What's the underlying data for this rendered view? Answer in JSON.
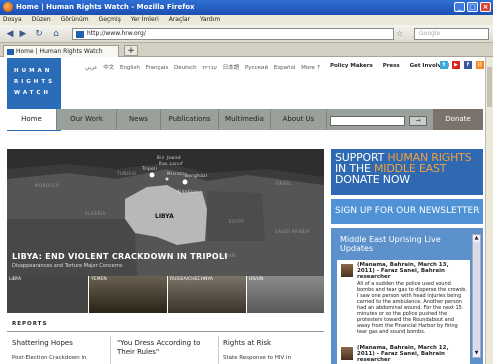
{
  "window": {
    "title": "Home | Human Rights Watch - Mozilla Firefox"
  },
  "menu": [
    "Dosya",
    "Düzen",
    "Görünüm",
    "Geçmiş",
    "Yer İmleri",
    "Araçlar",
    "Yardım"
  ],
  "toolbar": {
    "url": "http://www.hrw.org/",
    "search_placeholder": "Google"
  },
  "tab": {
    "label": "Home | Human Rights Watch",
    "new_tab": "+"
  },
  "site": {
    "logo_lines": [
      "HUMAN",
      "RIGHTS",
      "WATCH"
    ],
    "languages": [
      "عربي",
      "中文",
      "English",
      "Français",
      "Deutsch",
      "עברית",
      "日本語",
      "Русский",
      "Español",
      "More ↑"
    ],
    "top_links": [
      "Policy Makers",
      "Press",
      "Get Involved"
    ],
    "social_icons": [
      "twitter-icon",
      "youtube-icon",
      "facebook-icon",
      "rss-icon"
    ],
    "nav": [
      "Home",
      "Our Work",
      "News",
      "Publications",
      "Multimedia",
      "About Us"
    ],
    "donate": "Donate",
    "search_go": "→"
  },
  "feature": {
    "map_labels": [
      "MOROCCO",
      "ALGERIA",
      "TUNISIA",
      "LIBYA",
      "EGYPT",
      "Benghazi",
      "Tripoli",
      "Ajdabiya",
      "Ras Lanuf",
      "Misrata",
      "Bin Jawad",
      "ISRAEL",
      "SAUDI ARABIA",
      "SUDAN"
    ],
    "headline": "LIBYA: END VIOLENT CRACKDOWN IN TRIPOLI",
    "subhead": "Disappearances and Torture Major Concerns",
    "thumbs": [
      "LIBYA",
      "YEMEN",
      "RUSSIA/CHECHNYA",
      "US/UN"
    ]
  },
  "reports": {
    "heading": "REPORTS",
    "items": [
      {
        "title": "Shattering Hopes",
        "sub": "Post-Election Crackdown in"
      },
      {
        "title": "\"You Dress According to Their Rules\"",
        "sub": ""
      },
      {
        "title": "Rights at Risk",
        "sub": "State Response to HIV in"
      }
    ]
  },
  "sidebar": {
    "promo_line1": "SUPPORT ",
    "promo_orange1": "HUMAN RIGHTS",
    "promo_line2": "IN THE ",
    "promo_orange2": "MIDDLE EAST",
    "promo_line3": "DONATE NOW",
    "newsletter": "SIGN UP FOR OUR NEWSLETTER",
    "updates_title": "Middle East Uprising Live Updates",
    "entries": [
      {
        "title": "(Manama, Bahrain, March 13, 2011) - Faraz Sanei, Bahrain researcher",
        "body": "All of a sudden the police used sound bombs and tear gas to disperse the crowds. I saw one person with head injuries being carried to the ambulance. Another person had an abdominal wound. For the next 15 minutes or so the police pushed the protesters toward the Roundabout and away from the Financial Harbor by firing tear gas and sound bombs."
      },
      {
        "title": "(Manama, Bahrain, March 12, 2011) - Faraz Sanei, Bahrain researcher",
        "body": ""
      }
    ]
  },
  "colors": {
    "hrw_blue": "#2b6cb8",
    "orange": "#f4a23d",
    "nav_gray": "#9aa09a",
    "donate": "#7a736b"
  }
}
